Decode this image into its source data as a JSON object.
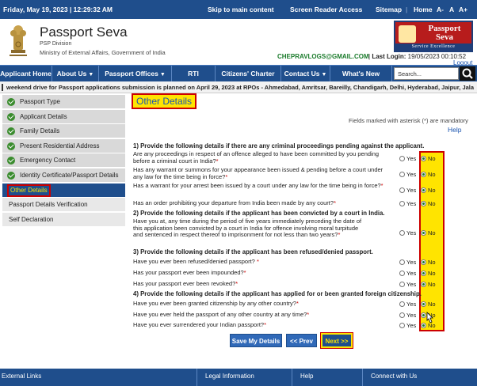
{
  "topbar": {
    "datetime": "Friday,  May  19, 2023 | 12:29:32 AM",
    "skip": "Skip to main content",
    "reader": "Screen Reader Access",
    "sitemap": "Sitemap",
    "home": "Home",
    "font_small": "A-",
    "font_normal": "A",
    "font_large": "A+"
  },
  "header": {
    "title": "Passport Seva",
    "division": "PSP Division",
    "ministry": "Ministry of External Affairs, Government of India",
    "logo_line1": "Passport",
    "logo_line2": "Seva",
    "logo_band": "Service Excellence",
    "email": "CHEPRAVLOGS@GMAIL.COM",
    "last_login_label": "Last Login:",
    "last_login_value": "19/05/2023 00:10:52",
    "logout": "Logout"
  },
  "nav": {
    "items": [
      "Applicant Home",
      "About Us",
      "Passport Offices",
      "RTI",
      "Citizens' Charter",
      "Contact Us",
      "What's New"
    ],
    "search_placeholder": "Search..."
  },
  "ticker": "weekend drive for Passport applications submission is planned on April 29, 2023 at RPOs - Ahmedabad, Amritsar, Bareilly, Chandigarh, Delhi, Hyderabad, Jaipur, Jala",
  "sidebar": {
    "items": [
      "Passport Type",
      "Applicant Details",
      "Family Details",
      "Present Residential Address",
      "Emergency Contact",
      "Identity Certificate/Passport Details",
      "Other Details",
      "Passport Details Verification",
      "Self Declaration"
    ]
  },
  "main": {
    "title": "Other Details",
    "mandatory_note": "Fields marked with asterisk (*) are mandatory",
    "help": "Help",
    "yes": "Yes",
    "no": "No",
    "sections": [
      "1) Provide the following details if there are any criminal proceedings pending against the applicant.",
      "2) Provide the following details if the applicant has been convicted by a court in India.",
      "3) Provide the following details if the applicant has been refused/denied passport.",
      "4) Provide the following details if the applicant has applied for or been granted foreign citizenship."
    ],
    "questions": [
      "Are any proceedings in respect of an offence alleged to have been committed by you pending before a criminal court in India?",
      "Has any warrant or summons for your appearance been issued & pending before a court under any law for the time being in force?",
      "Has a warrant for your arrest been issued by a court under any law for the time being in force?",
      "Has an order prohibiting your departure from India been made by any court?",
      "Have you at, any time during the period of five years immediately preceding the date of this application been convicted by a court in India for offence involving moral turpitude and sentenced in respect thereof to imprisonment for not less than two years?",
      "Have you ever been refused/denied passport?",
      "Has your passport ever been impounded?",
      "Has your passport ever been revoked?",
      "Have you ever been granted citizenship by any other country?",
      "Have you ever held the passport of any other country at any time?",
      "Have you ever surrendered your Indian passport?"
    ],
    "buttons": {
      "save": "Save My Details",
      "prev": "<< Prev",
      "next": "Next >>"
    }
  },
  "footer": {
    "items": [
      "External Links",
      "Legal Information",
      "Help",
      "Connect with Us"
    ]
  },
  "colors": {
    "nav_blue": "#1f4e8c",
    "highlight_yellow": "#ffe400",
    "highlight_red": "#cc0000",
    "email_green": "#1a7b2b"
  }
}
